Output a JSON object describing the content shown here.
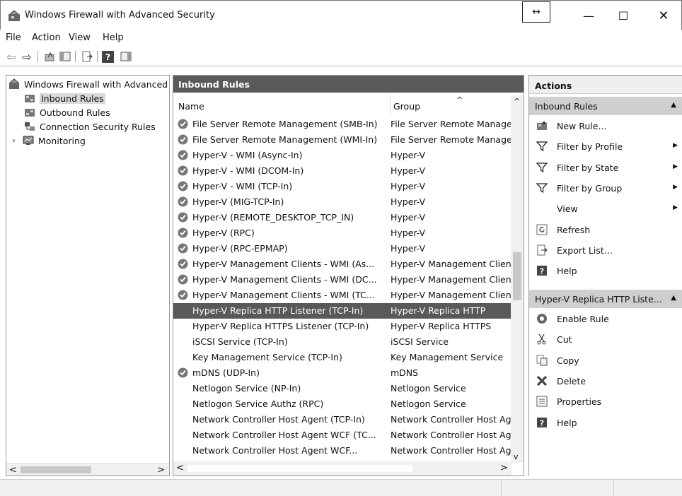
{
  "window": {
    "title": "Windows Firewall with Advanced Security",
    "resize_glyph": "↔",
    "minimize_glyph": "—",
    "maximize_glyph": "☐",
    "close_glyph": "✕"
  },
  "menu": [
    "File",
    "Action",
    "View",
    "Help"
  ],
  "toolbar": {
    "icons": [
      "back-arrow-icon",
      "forward-arrow-icon",
      "up-folder-icon",
      "show-hide-console-tree-icon",
      "export-list-icon",
      "help-icon",
      "show-hide-action-pane-icon"
    ],
    "back_glyph": "⇦",
    "forward_glyph": "⇨",
    "help_glyph": "?"
  },
  "tree": {
    "root": "Windows Firewall with Advanced Security",
    "items": [
      {
        "label": "Inbound Rules",
        "icon": "inbound-rules-icon",
        "selected": true
      },
      {
        "label": "Outbound Rules",
        "icon": "outbound-rules-icon"
      },
      {
        "label": "Connection Security Rules",
        "icon": "connection-security-icon"
      },
      {
        "label": "Monitoring",
        "icon": "monitoring-icon",
        "expander": "›"
      }
    ],
    "scroll_left": "<",
    "scroll_right": ">"
  },
  "middle": {
    "header": "Inbound Rules",
    "col_name": "Name",
    "col_group": "Group",
    "sort_glyph": "^",
    "rows": [
      {
        "name": "File Server Remote Management (SMB-In)",
        "group": "File Server Remote Management",
        "enabled": true
      },
      {
        "name": "File Server Remote Management (WMI-In)",
        "group": "File Server Remote Management",
        "enabled": true
      },
      {
        "name": "Hyper-V - WMI (Async-In)",
        "group": "Hyper-V",
        "enabled": true
      },
      {
        "name": "Hyper-V - WMI (DCOM-In)",
        "group": "Hyper-V",
        "enabled": true
      },
      {
        "name": "Hyper-V - WMI (TCP-In)",
        "group": "Hyper-V",
        "enabled": true
      },
      {
        "name": "Hyper-V (MIG-TCP-In)",
        "group": "Hyper-V",
        "enabled": true
      },
      {
        "name": "Hyper-V (REMOTE_DESKTOP_TCP_IN)",
        "group": "Hyper-V",
        "enabled": true
      },
      {
        "name": "Hyper-V (RPC)",
        "group": "Hyper-V",
        "enabled": true
      },
      {
        "name": "Hyper-V (RPC-EPMAP)",
        "group": "Hyper-V",
        "enabled": true
      },
      {
        "name": "Hyper-V Management Clients - WMI (As...",
        "group": "Hyper-V Management Clients",
        "enabled": true
      },
      {
        "name": "Hyper-V Management Clients - WMI (DC...",
        "group": "Hyper-V Management Clients",
        "enabled": true
      },
      {
        "name": "Hyper-V Management Clients - WMI (TC...",
        "group": "Hyper-V Management Clients",
        "enabled": true
      },
      {
        "name": "Hyper-V Replica HTTP Listener (TCP-In)",
        "group": "Hyper-V Replica HTTP",
        "enabled": false,
        "selected": true
      },
      {
        "name": "Hyper-V Replica HTTPS Listener (TCP-In)",
        "group": "Hyper-V Replica HTTPS",
        "enabled": false
      },
      {
        "name": "iSCSI Service (TCP-In)",
        "group": "iSCSI Service",
        "enabled": false
      },
      {
        "name": "Key Management Service (TCP-In)",
        "group": "Key Management Service",
        "enabled": false
      },
      {
        "name": "mDNS (UDP-In)",
        "group": "mDNS",
        "enabled": true
      },
      {
        "name": "Netlogon Service (NP-In)",
        "group": "Netlogon Service",
        "enabled": false
      },
      {
        "name": "Netlogon Service Authz (RPC)",
        "group": "Netlogon Service",
        "enabled": false
      },
      {
        "name": "Network Controller Host Agent (TCP-In)",
        "group": "Network Controller Host Agent",
        "enabled": false
      },
      {
        "name": "Network Controller Host Agent WCF (TC...",
        "group": "Network Controller Host Agent",
        "enabled": false
      },
      {
        "name": "Network Controller Host Agent WCF...",
        "group": "Network Controller Host Agent",
        "enabled": false
      }
    ],
    "scroll_up": "^",
    "scroll_down": "v",
    "scroll_left": "<",
    "scroll_right": ">"
  },
  "actions": {
    "title": "Actions",
    "section1": {
      "label": "Inbound Rules",
      "caret": "▲",
      "items": [
        {
          "label": "New Rule...",
          "icon": "new-rule-icon"
        },
        {
          "label": "Filter by Profile",
          "icon": "filter-icon",
          "submenu": "▶"
        },
        {
          "label": "Filter by State",
          "icon": "filter-icon",
          "submenu": "▶"
        },
        {
          "label": "Filter by Group",
          "icon": "filter-icon",
          "submenu": "▶"
        },
        {
          "label": "View",
          "icon": "",
          "submenu": "▶"
        },
        {
          "label": "Refresh",
          "icon": "refresh-icon"
        },
        {
          "label": "Export List...",
          "icon": "export-list-icon"
        },
        {
          "label": "Help",
          "icon": "help-icon"
        }
      ]
    },
    "section2": {
      "label": "Hyper-V Replica HTTP Liste...",
      "caret": "▲",
      "items": [
        {
          "label": "Enable Rule",
          "icon": "enable-rule-icon"
        },
        {
          "label": "Cut",
          "icon": "cut-icon"
        },
        {
          "label": "Copy",
          "icon": "copy-icon"
        },
        {
          "label": "Delete",
          "icon": "delete-icon"
        },
        {
          "label": "Properties",
          "icon": "properties-icon"
        },
        {
          "label": "Help",
          "icon": "help-icon"
        }
      ]
    }
  }
}
